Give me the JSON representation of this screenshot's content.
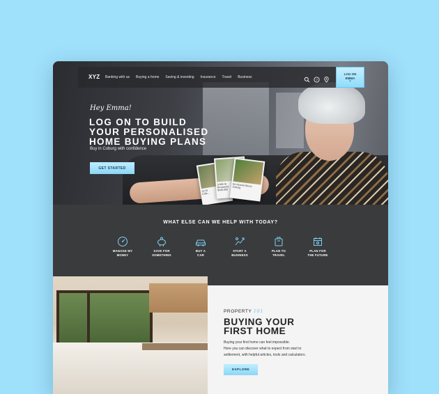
{
  "nav": {
    "logo": "XYZ",
    "links": [
      "Banking with us",
      "Buying a home",
      "Saving & investing",
      "Insurance",
      "Travel",
      "Business"
    ],
    "icons": [
      "search-icon",
      "help-icon",
      "location-icon"
    ],
    "login": {
      "line1": "LOG ON",
      "line2": "EMMA",
      "chevron": "˅"
    }
  },
  "hero": {
    "greeting": "Hey Emma!",
    "headline": "LOG ON TO BUILD\nYOUR PERSONALISED\nHOME BUYING PLANS",
    "subtitle": "Buy in Coburg with confidence",
    "cta": "GET STARTED",
    "cards": [
      {
        "text": "22 St\nColb..."
      },
      {
        "text": "3-900 St\nBrunswick\n$445,000"
      },
      {
        "text": "64 Victoria Street,\nCoburg"
      }
    ]
  },
  "help": {
    "title": "WHAT ELSE CAN WE HELP WITH TODAY?",
    "items": [
      {
        "label": "MANAGE MY\nMONEY",
        "icon": "gauge-icon"
      },
      {
        "label": "SAVE FOR\nSOMETHING",
        "icon": "piggy-bank-icon"
      },
      {
        "label": "BUY A\nCAR",
        "icon": "car-icon"
      },
      {
        "label": "START A\nBUSINESS",
        "icon": "growth-icon"
      },
      {
        "label": "PLAN TO\nTRAVEL",
        "icon": "suitcase-icon"
      },
      {
        "label": "PLAN FOR\nTHE FUTURE",
        "icon": "calendar-icon"
      }
    ]
  },
  "article": {
    "kicker": "PROPERTY",
    "kicker_num": "101",
    "title": "BUYING YOUR\nFIRST HOME",
    "body": "Buying your first home can feel impossible.\nHere you can discover what to expect from start to\nsettlement, with helpful articles, tools and calculators.",
    "cta": "EXPLORE"
  },
  "colors": {
    "accent": "#8bd7f7",
    "dark": "#3a3b3d",
    "icon": "#7fd0f2"
  }
}
